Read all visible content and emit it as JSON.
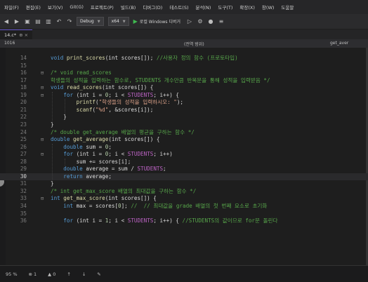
{
  "menu": [
    "파일(F)",
    "편집(E)",
    "보기(V)",
    "Git(G)",
    "프로젝트(P)",
    "빌드(B)",
    "디버그(D)",
    "테스트(S)",
    "분석(N)",
    "도구(T)",
    "확장(X)",
    "창(W)",
    "도움말"
  ],
  "toolbar": {
    "config": "Debug",
    "platform": "x64",
    "run_label": "로컬 Windows 디버거"
  },
  "tab": {
    "label": "14.c*",
    "pin": "⊕ ×"
  },
  "nav": {
    "project": "1016",
    "scope": "(전역 범위)",
    "function": "get_aver"
  },
  "lines": [
    {
      "n": "14",
      "segs": [
        [
          "kw",
          "void "
        ],
        [
          "fn",
          "print_scores"
        ],
        [
          "",
          "(int scores[]); "
        ],
        [
          "cm",
          "//사용자 정의 함수 (프로토타입)"
        ]
      ]
    },
    {
      "n": "15",
      "segs": []
    },
    {
      "n": "16",
      "fold": "⊟",
      "segs": [
        [
          "cm",
          "/* void read_scores"
        ]
      ]
    },
    {
      "n": "17",
      "segs": [
        [
          "cm",
          "학생들의 성적을 입력하는 함수로, STUDENTS 개수만큼 반복문을 통해 성적을 입력받음 */"
        ]
      ]
    },
    {
      "n": "18",
      "fold": "⊟",
      "segs": [
        [
          "kw",
          "void "
        ],
        [
          "fn",
          "read_scores"
        ],
        [
          "",
          "(int scores[]) {"
        ]
      ]
    },
    {
      "n": "19",
      "fold": "⊟",
      "segs": [
        [
          "",
          "    "
        ],
        [
          "kw",
          "for "
        ],
        [
          "",
          "(int i = "
        ],
        [
          "num",
          "0"
        ],
        [
          "",
          "; i < "
        ],
        [
          "mac",
          "STUDENTS"
        ],
        [
          "",
          "; i++) {"
        ]
      ]
    },
    {
      "n": "20",
      "segs": [
        [
          "",
          "        "
        ],
        [
          "fn",
          "printf"
        ],
        [
          "",
          "("
        ],
        [
          "str",
          "\"학생들의 성적을 입력하시오: \""
        ],
        [
          "",
          ");"
        ]
      ]
    },
    {
      "n": "21",
      "segs": [
        [
          "",
          "        "
        ],
        [
          "fn",
          "scanf"
        ],
        [
          "",
          "("
        ],
        [
          "str",
          "\"%d\""
        ],
        [
          "",
          ", &scores[i]);"
        ]
      ]
    },
    {
      "n": "22",
      "segs": [
        [
          "",
          "    }"
        ]
      ]
    },
    {
      "n": "23",
      "segs": [
        [
          "",
          "}"
        ]
      ]
    },
    {
      "n": "24",
      "segs": [
        [
          "cm",
          "/* double get_average 배열의 평균을 구하는 함수 */"
        ]
      ]
    },
    {
      "n": "25",
      "fold": "⊟",
      "segs": [
        [
          "kw",
          "double "
        ],
        [
          "fn",
          "get_average"
        ],
        [
          "",
          "(int scores[]) {"
        ]
      ]
    },
    {
      "n": "26",
      "segs": [
        [
          "",
          "    "
        ],
        [
          "kw",
          "double "
        ],
        [
          "",
          "sum = "
        ],
        [
          "num",
          "0"
        ],
        [
          "",
          ";"
        ]
      ]
    },
    {
      "n": "27",
      "fold": "⊟",
      "segs": [
        [
          "",
          "    "
        ],
        [
          "kw",
          "for "
        ],
        [
          "",
          "(int i = "
        ],
        [
          "num",
          "0"
        ],
        [
          "",
          "; i < "
        ],
        [
          "mac",
          "STUDENTS"
        ],
        [
          "",
          "; i++)"
        ]
      ]
    },
    {
      "n": "28",
      "segs": [
        [
          "",
          "        sum += scores[i];"
        ]
      ]
    },
    {
      "n": "29",
      "segs": [
        [
          "",
          "    "
        ],
        [
          "kw",
          "double "
        ],
        [
          "",
          "average = sum / "
        ],
        [
          "mac",
          "STUDENTS"
        ],
        [
          "",
          ";"
        ]
      ]
    },
    {
      "n": "30",
      "current": true,
      "segs": [
        [
          "",
          "    "
        ],
        [
          "kw",
          "return "
        ],
        [
          "",
          "average;"
        ]
      ]
    },
    {
      "n": "31",
      "segs": [
        [
          "",
          "}"
        ]
      ]
    },
    {
      "n": "32",
      "segs": [
        [
          "cm",
          "/* int get_max_score 배열의 최대값을 구하는 함수 */"
        ]
      ]
    },
    {
      "n": "33",
      "fold": "⊟",
      "segs": [
        [
          "kw",
          "int "
        ],
        [
          "fn",
          "get_max_score"
        ],
        [
          "",
          "(int scores[]) {"
        ]
      ]
    },
    {
      "n": "34",
      "segs": [
        [
          "",
          "    "
        ],
        [
          "kw",
          "int "
        ],
        [
          "",
          "max = scores["
        ],
        [
          "num",
          "0"
        ],
        [
          "",
          "]; "
        ],
        [
          "cm",
          "//  // 최대값을 grade 배열의 첫 번째 요소로 초기화"
        ]
      ]
    },
    {
      "n": "35",
      "segs": []
    },
    {
      "n": "36",
      "segs": [
        [
          "",
          "    "
        ],
        [
          "kw",
          "for "
        ],
        [
          "",
          "(int i = "
        ],
        [
          "num",
          "1"
        ],
        [
          "",
          "; i < "
        ],
        [
          "mac",
          "STUDENTS"
        ],
        [
          "",
          "; i++) { "
        ],
        [
          "cm",
          "//STUDENTS의 값이므로 for문 돌린다"
        ]
      ]
    }
  ],
  "status": {
    "zoom": "95 %",
    "errors": "1",
    "warnings": "0"
  },
  "colors": {
    "editor_bg": "#1e1e1e",
    "keyword": "#569cd6",
    "comment": "#57a64a",
    "function": "#dcdcaa"
  }
}
